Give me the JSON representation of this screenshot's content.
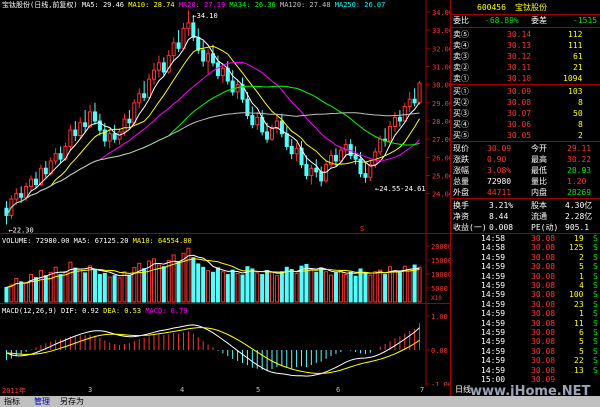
{
  "header": {
    "stock_title": "宝钛股份(日线,前复权)",
    "ma5_label": "MA5: 29.46",
    "ma10_label": "MA10: 28.74",
    "ma20_label": "MA20: 27.19",
    "ma34_label": "MA34: 26.36",
    "ma120_label": "MA120: 27.48",
    "ma250_label": "MA250: 26.07"
  },
  "volume_header": {
    "label": "VOLUME: 72980.00",
    "ma5": "MA5: 67125.20",
    "ma10": "MA10: 64554.80"
  },
  "macd_header": {
    "label": "MACD(12,26,9)",
    "dif": "DIF: 0.92",
    "dea": "DEA: 0.53",
    "macd": "MACD: 0.79"
  },
  "annotations": {
    "high": "34.10",
    "low": "22.30",
    "mid": "24.55-24.61",
    "marker": "S"
  },
  "x_axis": [
    "2011年",
    "3",
    "4",
    "5",
    "6",
    "7"
  ],
  "quote": {
    "code": "600456",
    "name": "宝钛股份",
    "webi_label": "委比",
    "webi_value": "-68.89%",
    "wecha_label": "委差",
    "wecha_value": "-1515",
    "asks": [
      {
        "label": "卖⑤",
        "price": "30.14",
        "vol": "112"
      },
      {
        "label": "卖④",
        "price": "30.13",
        "vol": "111"
      },
      {
        "label": "卖③",
        "price": "30.12",
        "vol": "61"
      },
      {
        "label": "卖②",
        "price": "30.11",
        "vol": "21"
      },
      {
        "label": "卖①",
        "price": "30.10",
        "vol": "1094"
      }
    ],
    "bids": [
      {
        "label": "买①",
        "price": "30.09",
        "vol": "103"
      },
      {
        "label": "买②",
        "price": "30.08",
        "vol": "8"
      },
      {
        "label": "买③",
        "price": "30.07",
        "vol": "50"
      },
      {
        "label": "买④",
        "price": "30.06",
        "vol": "8"
      },
      {
        "label": "买⑤",
        "price": "30.05",
        "vol": "2"
      }
    ],
    "stats": [
      {
        "l1": "现价",
        "v1": "30.09",
        "c1": "red",
        "l2": "今开",
        "v2": "29.11",
        "c2": "red"
      },
      {
        "l1": "涨跌",
        "v1": "0.90",
        "c1": "red",
        "l2": "最高",
        "v2": "30.22",
        "c2": "red"
      },
      {
        "l1": "涨幅",
        "v1": "3.08%",
        "c1": "red",
        "l2": "最低",
        "v2": "28.93",
        "c2": "grn"
      },
      {
        "l1": "总量",
        "v1": "72980",
        "c1": "wht",
        "l2": "量比",
        "v2": "1.20",
        "c2": "red"
      },
      {
        "l1": "外盘",
        "v1": "44711",
        "c1": "red",
        "l2": "内盘",
        "v2": "28269",
        "c2": "grn"
      }
    ],
    "stats2": [
      {
        "l1": "换手",
        "v1": "3.21%",
        "l2": "股本",
        "v2": "4.30亿"
      },
      {
        "l1": "净资",
        "v1": "8.44",
        "l2": "流通",
        "v2": "2.28亿"
      },
      {
        "l1": "收益(一)",
        "v1": "0.008",
        "l2": "PE(动)",
        "v2": "905.1"
      }
    ],
    "ticks": [
      {
        "t": "14:58",
        "p": "30.08",
        "v": "19",
        "s": "S"
      },
      {
        "t": "14:58",
        "p": "30.08",
        "v": "125",
        "s": "S"
      },
      {
        "t": "14:59",
        "p": "30.08",
        "v": "2",
        "s": "S"
      },
      {
        "t": "14:59",
        "p": "30.08",
        "v": "5",
        "s": "S"
      },
      {
        "t": "14:59",
        "p": "30.08",
        "v": "1",
        "s": "S"
      },
      {
        "t": "14:59",
        "p": "30.08",
        "v": "4",
        "s": "S"
      },
      {
        "t": "14:59",
        "p": "30.08",
        "v": "100",
        "s": "S"
      },
      {
        "t": "14:59",
        "p": "30.08",
        "v": "23",
        "s": "S"
      },
      {
        "t": "14:59",
        "p": "30.08",
        "v": "1",
        "s": "S"
      },
      {
        "t": "14:59",
        "p": "30.08",
        "v": "11",
        "s": "S"
      },
      {
        "t": "14:59",
        "p": "30.08",
        "v": "6",
        "s": "S"
      },
      {
        "t": "14:59",
        "p": "30.08",
        "v": "5",
        "s": "S"
      },
      {
        "t": "14:59",
        "p": "30.08",
        "v": "5",
        "s": "S"
      },
      {
        "t": "14:59",
        "p": "30.08",
        "v": "22",
        "s": "S"
      },
      {
        "t": "14:59",
        "p": "30.08",
        "v": "13",
        "s": "S"
      },
      {
        "t": "15:00",
        "p": "30.09",
        "v": "",
        "s": ""
      }
    ],
    "tab_label": "日线"
  },
  "bottom_bar": {
    "items": [
      "指标",
      "管理",
      "另存为"
    ]
  },
  "watermark": "www.jHome.NET",
  "colors": {
    "up": "#ff3232",
    "down": "#54fcfc",
    "ma5": "#ffffff",
    "ma10": "#ffff00",
    "ma20": "#ff00ff",
    "ma34": "#00ff00",
    "ma120": "#c0c0c0"
  },
  "chart_data": [
    {
      "type": "candlestick",
      "title": "宝钛股份(日线,前复权)",
      "ylim": [
        22,
        34
      ],
      "y_ticks": [
        24,
        25,
        26,
        27,
        28,
        29,
        30,
        31,
        32,
        33,
        34
      ],
      "ohlc": [
        [
          23.2,
          23.6,
          22.3,
          22.8
        ],
        [
          22.8,
          23.9,
          22.6,
          23.7
        ],
        [
          23.7,
          24.3,
          23.4,
          24.0
        ],
        [
          24.0,
          24.4,
          23.5,
          23.8
        ],
        [
          23.8,
          24.6,
          23.6,
          24.4
        ],
        [
          24.4,
          25.0,
          24.1,
          24.8
        ],
        [
          24.8,
          25.2,
          24.3,
          24.5
        ],
        [
          24.5,
          25.6,
          24.4,
          25.4
        ],
        [
          25.4,
          25.8,
          24.9,
          25.1
        ],
        [
          25.1,
          26.0,
          25.0,
          25.8
        ],
        [
          25.8,
          26.5,
          25.6,
          26.2
        ],
        [
          26.2,
          26.6,
          25.7,
          25.9
        ],
        [
          25.9,
          26.8,
          25.8,
          26.6
        ],
        [
          26.6,
          27.8,
          26.4,
          27.5
        ],
        [
          27.5,
          28.0,
          26.9,
          27.2
        ],
        [
          27.2,
          28.2,
          27.0,
          27.9
        ],
        [
          27.9,
          28.6,
          27.4,
          27.7
        ],
        [
          27.7,
          28.9,
          27.6,
          28.5
        ],
        [
          28.5,
          29.0,
          27.8,
          28.0
        ],
        [
          28.0,
          28.4,
          27.2,
          27.5
        ],
        [
          27.5,
          27.9,
          26.6,
          26.9
        ],
        [
          26.9,
          27.6,
          26.5,
          27.3
        ],
        [
          27.3,
          27.8,
          26.8,
          27.0
        ],
        [
          27.0,
          27.6,
          26.7,
          27.4
        ],
        [
          27.4,
          28.4,
          27.2,
          28.1
        ],
        [
          28.1,
          28.6,
          27.6,
          27.9
        ],
        [
          27.9,
          29.2,
          27.8,
          29.0
        ],
        [
          29.0,
          29.8,
          28.7,
          29.5
        ],
        [
          29.5,
          30.2,
          29.1,
          29.3
        ],
        [
          29.3,
          30.6,
          29.2,
          30.3
        ],
        [
          30.3,
          31.2,
          30.0,
          30.8
        ],
        [
          30.8,
          31.6,
          30.4,
          31.2
        ],
        [
          31.2,
          31.5,
          30.5,
          30.7
        ],
        [
          30.7,
          31.9,
          30.6,
          31.6
        ],
        [
          31.6,
          32.6,
          31.3,
          32.3
        ],
        [
          32.3,
          33.0,
          31.8,
          32.0
        ],
        [
          32.0,
          33.4,
          31.9,
          33.1
        ],
        [
          33.1,
          34.1,
          32.7,
          33.4
        ],
        [
          33.4,
          33.8,
          32.4,
          32.6
        ],
        [
          32.6,
          33.1,
          31.7,
          31.9
        ],
        [
          31.9,
          32.4,
          31.0,
          31.3
        ],
        [
          31.3,
          32.0,
          30.6,
          31.7
        ],
        [
          31.7,
          32.2,
          31.0,
          31.2
        ],
        [
          31.2,
          31.6,
          30.3,
          30.5
        ],
        [
          30.5,
          31.2,
          30.1,
          30.9
        ],
        [
          30.9,
          31.3,
          30.0,
          30.2
        ],
        [
          30.2,
          30.8,
          29.4,
          29.6
        ],
        [
          29.6,
          30.3,
          29.2,
          30.0
        ],
        [
          30.0,
          30.4,
          29.0,
          29.2
        ],
        [
          29.2,
          29.6,
          28.1,
          28.3
        ],
        [
          28.3,
          28.8,
          27.6,
          27.8
        ],
        [
          27.8,
          28.5,
          27.5,
          28.2
        ],
        [
          28.2,
          28.6,
          27.2,
          27.4
        ],
        [
          27.4,
          27.9,
          26.8,
          27.0
        ],
        [
          27.0,
          27.8,
          26.9,
          27.6
        ],
        [
          27.6,
          28.3,
          27.3,
          28.0
        ],
        [
          28.0,
          28.4,
          27.1,
          27.3
        ],
        [
          27.3,
          27.7,
          26.4,
          26.6
        ],
        [
          26.6,
          27.0,
          25.9,
          26.2
        ],
        [
          26.2,
          26.8,
          25.8,
          26.5
        ],
        [
          26.5,
          26.9,
          25.4,
          25.6
        ],
        [
          25.6,
          26.1,
          24.8,
          25.0
        ],
        [
          25.0,
          25.6,
          24.5,
          25.4
        ],
        [
          25.4,
          25.9,
          24.9,
          25.2
        ],
        [
          25.2,
          25.5,
          24.4,
          24.7
        ],
        [
          24.7,
          25.8,
          24.6,
          25.6
        ],
        [
          25.6,
          26.4,
          25.4,
          26.1
        ],
        [
          26.1,
          26.5,
          25.5,
          25.8
        ],
        [
          25.8,
          26.6,
          25.7,
          26.4
        ],
        [
          26.4,
          27.0,
          26.0,
          26.7
        ],
        [
          26.7,
          27.0,
          25.9,
          26.1
        ],
        [
          26.1,
          26.6,
          25.6,
          25.9
        ],
        [
          25.9,
          26.3,
          24.9,
          25.1
        ],
        [
          25.1,
          25.7,
          24.6,
          24.9
        ],
        [
          24.9,
          25.8,
          24.7,
          25.6
        ],
        [
          25.6,
          26.5,
          25.4,
          26.3
        ],
        [
          26.3,
          27.2,
          26.1,
          27.0
        ],
        [
          27.0,
          27.6,
          26.6,
          26.9
        ],
        [
          26.9,
          28.0,
          26.8,
          27.7
        ],
        [
          27.7,
          28.5,
          27.4,
          28.2
        ],
        [
          28.2,
          28.6,
          27.7,
          28.0
        ],
        [
          28.0,
          29.0,
          27.9,
          28.8
        ],
        [
          28.8,
          29.6,
          28.5,
          29.2
        ],
        [
          29.2,
          29.8,
          28.8,
          29.0
        ],
        [
          29.0,
          30.2,
          28.9,
          30.09
        ]
      ]
    },
    {
      "type": "bar",
      "title": "VOLUME",
      "ylim": [
        0,
        20000
      ],
      "y_ticks": [
        5000,
        10000,
        15000,
        20000
      ],
      "values": [
        5200,
        6100,
        8400,
        7200,
        6900,
        9800,
        8700,
        11200,
        9400,
        10600,
        12400,
        9800,
        10900,
        14200,
        12100,
        11800,
        10400,
        12900,
        11600,
        9800,
        10200,
        8900,
        9400,
        8600,
        10800,
        9600,
        12300,
        13800,
        11900,
        14600,
        15400,
        13200,
        12600,
        14900,
        16800,
        14200,
        17400,
        19200,
        15800,
        13600,
        12400,
        11200,
        10600,
        12200,
        10800,
        9800,
        11400,
        10200,
        9600,
        12600,
        11800,
        10400,
        9800,
        11200,
        10600,
        9400,
        10800,
        12400,
        11600,
        10200,
        12800,
        13400,
        11800,
        10600,
        12200,
        10800,
        9600,
        10400,
        11200,
        9800,
        10600,
        9200,
        11800,
        10400,
        9600,
        10800,
        11400,
        9800,
        12600,
        11200,
        10400,
        12800,
        11600,
        13200,
        12400
      ]
    },
    {
      "type": "bar",
      "title": "MACD(12,26,9)",
      "ylim": [
        -1.0,
        1.0
      ],
      "y_ticks": [
        -1.0,
        0,
        1.0
      ],
      "values": [
        -0.3,
        -0.25,
        -0.18,
        -0.12,
        -0.05,
        0.02,
        0.08,
        0.15,
        0.2,
        0.25,
        0.3,
        0.32,
        0.35,
        0.4,
        0.42,
        0.44,
        0.43,
        0.45,
        0.42,
        0.36,
        0.28,
        0.22,
        0.18,
        0.15,
        0.18,
        0.2,
        0.26,
        0.32,
        0.36,
        0.4,
        0.44,
        0.46,
        0.44,
        0.46,
        0.5,
        0.48,
        0.52,
        0.55,
        0.48,
        0.38,
        0.26,
        0.16,
        0.08,
        -0.02,
        -0.1,
        -0.18,
        -0.26,
        -0.32,
        -0.38,
        -0.45,
        -0.52,
        -0.55,
        -0.58,
        -0.6,
        -0.56,
        -0.5,
        -0.48,
        -0.52,
        -0.54,
        -0.5,
        -0.48,
        -0.5,
        -0.44,
        -0.38,
        -0.34,
        -0.26,
        -0.18,
        -0.12,
        -0.06,
        0.0,
        -0.02,
        -0.06,
        -0.1,
        -0.12,
        -0.08,
        0.0,
        0.1,
        0.18,
        0.26,
        0.34,
        0.4,
        0.48,
        0.56,
        0.62,
        0.79
      ]
    }
  ]
}
